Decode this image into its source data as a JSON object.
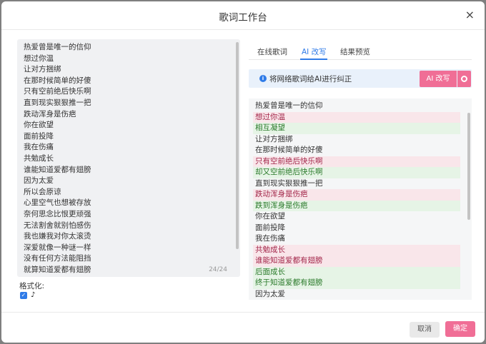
{
  "dialog": {
    "title": "歌词工作台",
    "close_glyph": "×"
  },
  "left": {
    "lines": [
      "热爱曾是唯一的信仰",
      "想过你温",
      "让对方捆绑",
      "在那时候简单的好傻",
      "只有空前绝后快乐啊",
      "直到现实狠狠推一把",
      "跌动浑身是伤疤",
      "你在欲望",
      "面前投降",
      "我在伤痛",
      "共勉成长",
      "谁能知道爱都有翅膀",
      "因为太爱",
      "所以会原谅",
      "心里空气也想被存放",
      "奈何思念比恨更顽强",
      "无法割舍就别怕感伤",
      "我也嫌我对你太滚烫",
      "深爱就像一种谜一样",
      "没有任何方法能阻挡",
      "就算知道爱都有翅膀"
    ],
    "counter": "24/24",
    "format_label": "格式化:",
    "format_option_icon": "music-note-icon",
    "format_option_glyph": "♪"
  },
  "tabs": [
    {
      "label": "在线歌词"
    },
    {
      "label": "AI 改写"
    },
    {
      "label": "结果预览"
    }
  ],
  "info": {
    "text": "将网络歌词给AI进行纠正",
    "icon_glyph": "i",
    "ai_button": "AI 改写"
  },
  "right": {
    "lines": [
      {
        "text": "热爱曾是唯一的信仰",
        "type": "same"
      },
      {
        "text": "想过你温",
        "type": "del"
      },
      {
        "text": "相互凝望",
        "type": "add"
      },
      {
        "text": "让对方捆绑",
        "type": "same"
      },
      {
        "text": "在那时候简单的好傻",
        "type": "same"
      },
      {
        "text": "只有空前绝后快乐啊",
        "type": "del"
      },
      {
        "text": "却又空前绝后快乐啊",
        "type": "add"
      },
      {
        "text": "直到现实狠狠推一把",
        "type": "same"
      },
      {
        "text": "跌动浑身是伤疤",
        "type": "del"
      },
      {
        "text": "跌到浑身是伤疤",
        "type": "add"
      },
      {
        "text": "你在欲望",
        "type": "same"
      },
      {
        "text": "面前投降",
        "type": "same"
      },
      {
        "text": "我在伤痛",
        "type": "same"
      },
      {
        "text": "共勉成长",
        "type": "del"
      },
      {
        "text": "谁能知道爱都有翅膀",
        "type": "del"
      },
      {
        "text": "后面成长",
        "type": "add"
      },
      {
        "text": "终于知道爱都有翅膀",
        "type": "add"
      },
      {
        "text": "因为太爱",
        "type": "same"
      }
    ]
  },
  "footer": {
    "cancel": "取消",
    "ok": "确定"
  },
  "colors": {
    "accent_pink": "#f06e96",
    "accent_blue": "#2f7be8",
    "deleted_text": "#a3274a",
    "added_text": "#2a7a2a"
  }
}
